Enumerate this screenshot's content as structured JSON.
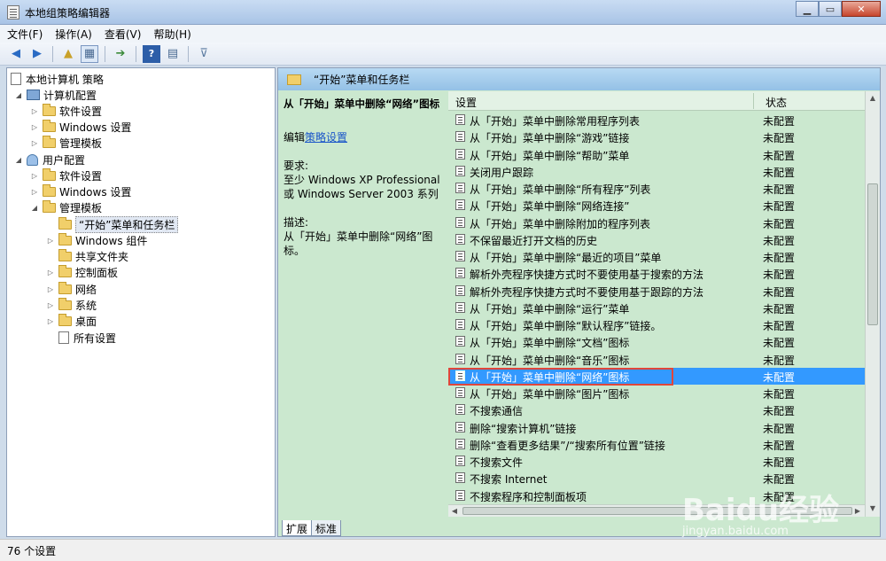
{
  "window": {
    "title": "本地组策略编辑器"
  },
  "menu": [
    "文件(F)",
    "操作(A)",
    "查看(V)",
    "帮助(H)"
  ],
  "toolbar": [
    "back-icon",
    "forward-icon",
    "up-folder-icon",
    "show-hide-tree-icon",
    "export-icon",
    "help-icon",
    "properties-icon",
    "filter-icon"
  ],
  "tree": {
    "root": "本地计算机 策略",
    "computer_config": "计算机配置",
    "computer_software": "软件设置",
    "computer_windows": "Windows 设置",
    "computer_templates": "管理模板",
    "user_config": "用户配置",
    "user_software": "软件设置",
    "user_windows": "Windows 设置",
    "user_templates": "管理模板",
    "start_menu": "“开始”菜单和任务栏",
    "windows_components": "Windows 组件",
    "shared_folders": "共享文件夹",
    "control_panel": "控制面板",
    "network": "网络",
    "system": "系统",
    "desktop": "桌面",
    "all_settings": "所有设置"
  },
  "content": {
    "header": "“开始”菜单和任务栏",
    "detail_title": "从「开始」菜单中删除“网络”图标",
    "edit_prefix": "编辑",
    "edit_link": "策略设置",
    "requirement_label": "要求:",
    "requirement_text": "至少 Windows XP Professional 或 Windows Server 2003 系列",
    "description_label": "描述:",
    "description_text": "从「开始」菜单中删除“网络”图标。",
    "col_setting": "设置",
    "col_state": "状态",
    "rows": [
      {
        "name": "从「开始」菜单中删除常用程序列表",
        "state": "未配置"
      },
      {
        "name": "从「开始」菜单中删除“游戏”链接",
        "state": "未配置"
      },
      {
        "name": "从「开始」菜单中删除“帮助”菜单",
        "state": "未配置"
      },
      {
        "name": "关闭用户跟踪",
        "state": "未配置"
      },
      {
        "name": "从「开始」菜单中删除“所有程序”列表",
        "state": "未配置"
      },
      {
        "name": "从「开始」菜单中删除“网络连接”",
        "state": "未配置"
      },
      {
        "name": "从「开始」菜单中删除附加的程序列表",
        "state": "未配置"
      },
      {
        "name": "不保留最近打开文档的历史",
        "state": "未配置"
      },
      {
        "name": "从「开始」菜单中删除“最近的项目”菜单",
        "state": "未配置"
      },
      {
        "name": "解析外壳程序快捷方式时不要使用基于搜索的方法",
        "state": "未配置"
      },
      {
        "name": "解析外壳程序快捷方式时不要使用基于跟踪的方法",
        "state": "未配置"
      },
      {
        "name": "从「开始」菜单中删除“运行”菜单",
        "state": "未配置"
      },
      {
        "name": "从「开始」菜单中删除“默认程序”链接。",
        "state": "未配置"
      },
      {
        "name": "从「开始」菜单中删除“文档”图标",
        "state": "未配置"
      },
      {
        "name": "从「开始」菜单中删除“音乐”图标",
        "state": "未配置"
      },
      {
        "name": "从「开始」菜单中删除“网络”图标",
        "state": "未配置"
      },
      {
        "name": "从「开始」菜单中删除“图片”图标",
        "state": "未配置"
      },
      {
        "name": "不搜索通信",
        "state": "未配置"
      },
      {
        "name": "删除“搜索计算机”链接",
        "state": "未配置"
      },
      {
        "name": "删除“查看更多结果”/“搜索所有位置”链接",
        "state": "未配置"
      },
      {
        "name": "不搜索文件",
        "state": "未配置"
      },
      {
        "name": "不搜索 Internet",
        "state": "未配置"
      },
      {
        "name": "不搜索程序和控制面板项",
        "state": "未配置"
      }
    ],
    "selected_index": 15
  },
  "tabs": [
    "扩展",
    "标准"
  ],
  "status": "76 个设置",
  "watermark": {
    "brand": "Baidu经验",
    "url": "jingyan.baidu.com"
  }
}
